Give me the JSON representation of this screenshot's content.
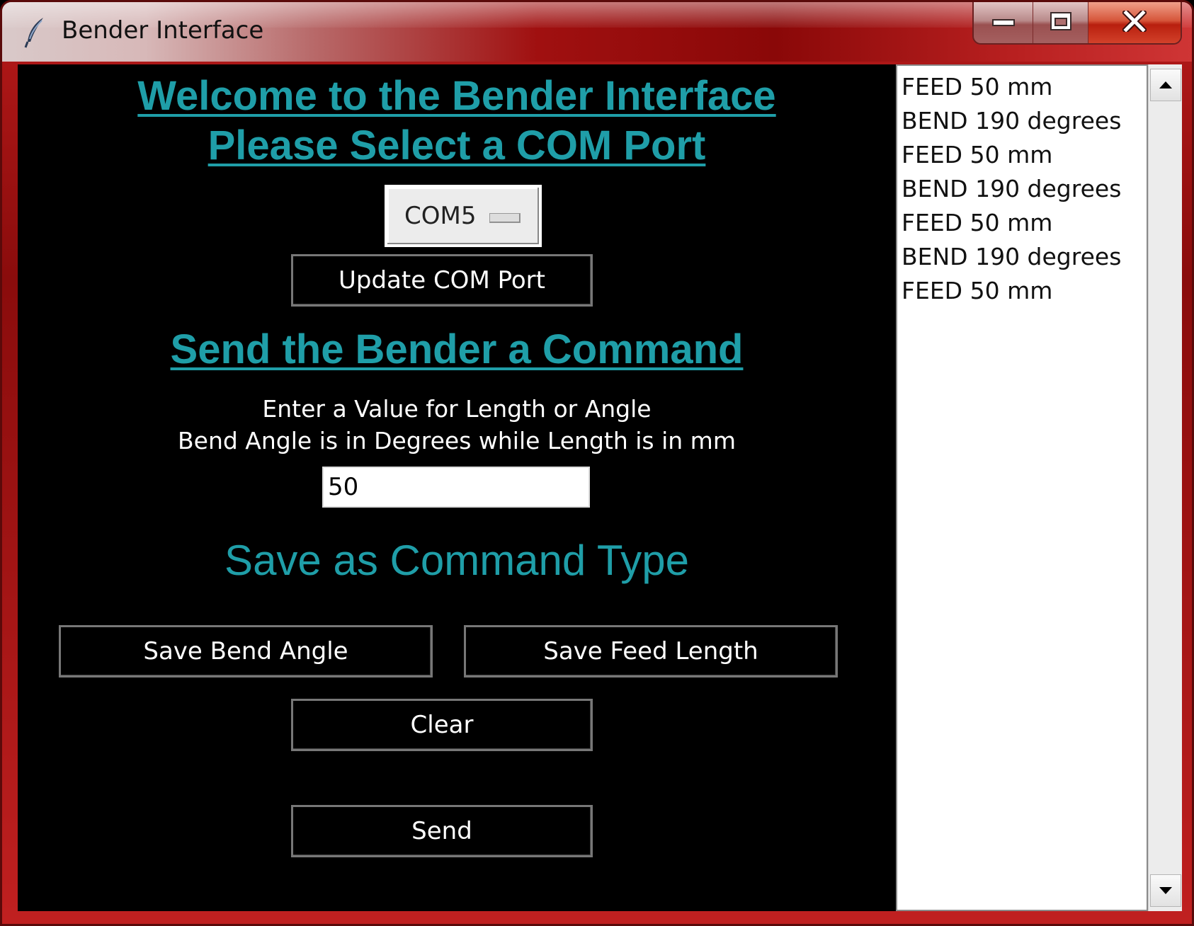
{
  "window": {
    "title": "Bender Interface",
    "controls": [
      "minimize-icon",
      "maximize-icon",
      "close-icon"
    ]
  },
  "main": {
    "welcome_heading": "Welcome to the Bender Interface",
    "select_port_heading": "Please Select a COM Port",
    "com_port": {
      "selected": "COM5"
    },
    "update_button": "Update COM Port",
    "command_heading": "Send the Bender a Command",
    "instructions": [
      "Enter a Value for Length or Angle",
      "Bend Angle is in Degrees while Length is in mm"
    ],
    "value_input": {
      "value": "50"
    },
    "save_heading": "Save as Command Type",
    "save_bend_button": "Save Bend Angle",
    "save_feed_button": "Save Feed Length",
    "clear_button": "Clear",
    "send_button": "Send"
  },
  "command_list": {
    "items": [
      "FEED 50 mm",
      "BEND 190 degrees",
      "FEED 50 mm",
      "BEND 190 degrees",
      "FEED 50 mm",
      "BEND 190 degrees",
      "FEED 50 mm"
    ]
  },
  "colors": {
    "heading_accent": "#1f9ea8",
    "client_background": "#000000",
    "window_frame": "#a01414"
  }
}
